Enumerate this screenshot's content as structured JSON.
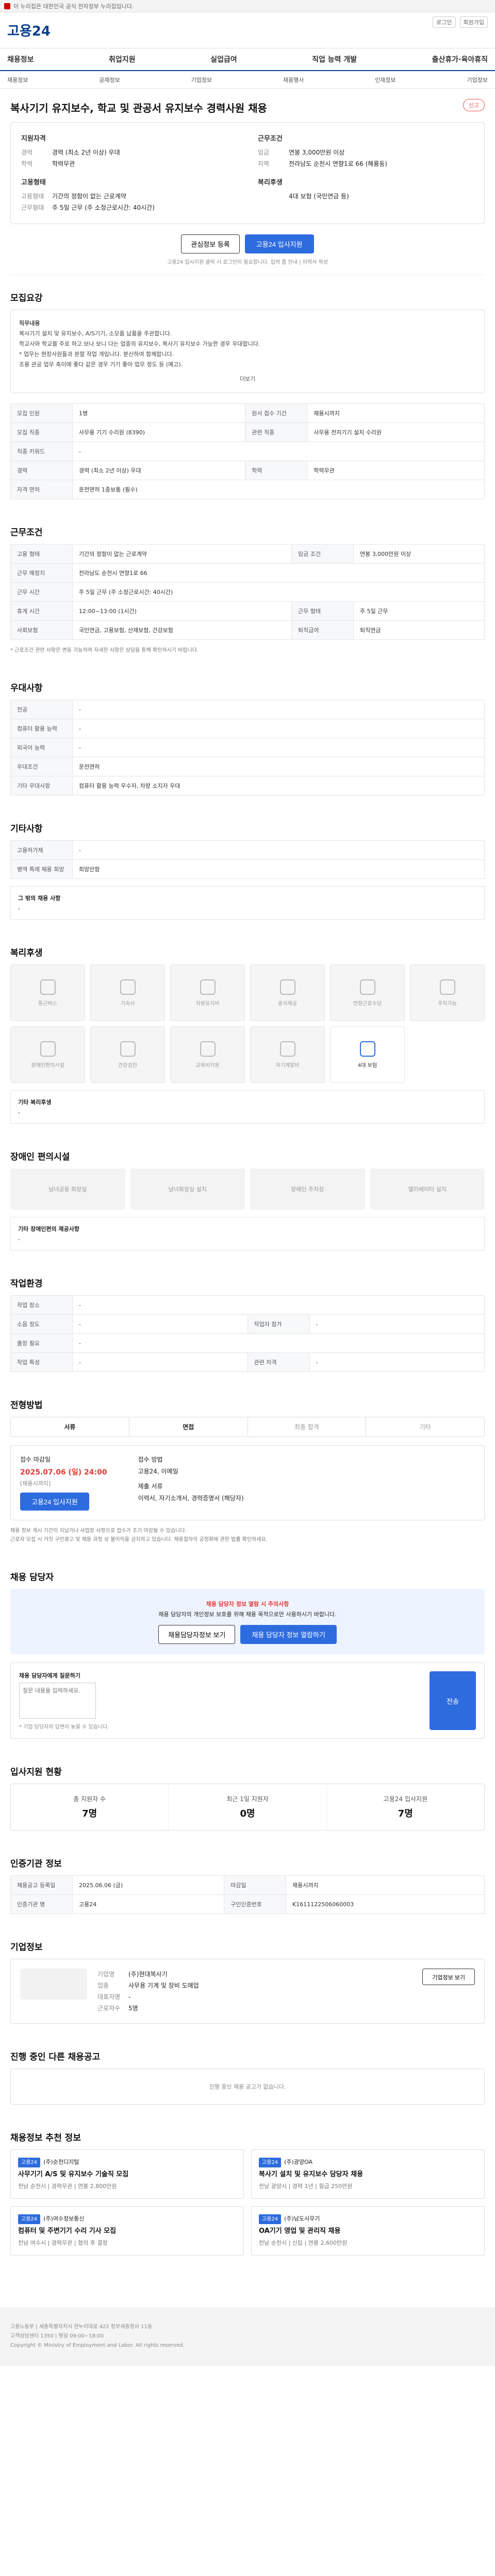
{
  "topbar": {
    "text": "이 누리집은 대한민국 공식 전자정부 누리집입니다."
  },
  "header": {
    "logo_main": "고용24",
    "links": [
      "로그인",
      "회원가입"
    ]
  },
  "gnb": [
    "채용정보",
    "취업지원",
    "실업급여",
    "직업 능력 개발",
    "출산휴가·육아휴직"
  ],
  "subnav": [
    "채용정보",
    "공채정보",
    "기업정보",
    "채용행사",
    "인재정보",
    "기업정보"
  ],
  "job": {
    "title": "복사기기 유지보수, 학교 및 관공서 유지보수 경력사원 채용",
    "report": "신고"
  },
  "summary": {
    "left_title": "지원자격",
    "left": [
      {
        "k": "경력",
        "v": "경력 (최소 2년 이상) 우대"
      },
      {
        "k": "학력",
        "v": "학력무관"
      }
    ],
    "left_title2": "고용형태",
    "left2": [
      {
        "k": "고용형태",
        "v": "기간의 정함이 없는 근로계약"
      },
      {
        "k": "근무형태",
        "v": "주 5일 근무 (주 소정근로시간: 40시간)"
      }
    ],
    "right_title": "근무조건",
    "right": [
      {
        "k": "임금",
        "v": "연봉 3,000만원 이상"
      },
      {
        "k": "지역",
        "v": "전라남도 순천시 연향1로 66 (해룡동)"
      }
    ],
    "right_title2": "복리후생",
    "right2": [
      {
        "k": "",
        "v": "4대 보험 (국민연금 등)"
      }
    ]
  },
  "actions": {
    "save": "관심정보 등록",
    "apply": "고용24 입사지원",
    "note": "고용24 입사지원 클릭 시 로그인이 필요합니다. 입력 폼 안내 | 이력서 작성"
  },
  "desc": {
    "title": "모집요강",
    "lines": [
      "직무내용",
      "복사기기 설치 및 유지보수, A/S기기, 소모품 납품을 주관합니다.",
      "학교사와 학교를 주로 하고 보나 보니 다는 업종의 유지보수, 복사기 유지보수 가능한 경우 우대합니다.",
      "* 업무는 현장사원들과 분할 작업 개입니다. 분산하여 함께합니다.",
      "조용 관공 업무 축이에 좋다 같은 경우 기기 좋아 업무 정도 등 (예고)."
    ],
    "more": "더보기"
  },
  "recruit_table": {
    "title": "",
    "rows": [
      [
        "모집 인원",
        "1명",
        "원서 접수 기간",
        "채용시까지"
      ],
      [
        "모집 직종",
        "사무용 기기 수리원 (8390)",
        "관련 직종",
        "사무용 전자기기 설치 수리원"
      ],
      [
        "직종 키워드",
        "-",
        "",
        ""
      ],
      [
        "경력",
        "경력 (최소 2년 이상) 우대",
        "학력",
        "학력무관"
      ],
      [
        "자격 면허",
        "운전면허 1종보통 (필수)",
        "",
        ""
      ]
    ]
  },
  "work_cond": {
    "title": "근무조건",
    "rows": [
      [
        "고용 형태",
        "기간의 정함이 없는 근로계약",
        "임금 조건",
        "연봉 3,000만원 이상"
      ],
      [
        "근무 예정지",
        "전라남도 순천시 연향1로 66",
        "",
        ""
      ],
      [
        "근무 시간",
        "주 5일 근무 (주 소정근로시간: 40시간)",
        "",
        ""
      ],
      [
        "휴게 시간",
        "12:00~13:00 (1시간)",
        "근무 형태",
        "주 5일 근무"
      ],
      [
        "사회보험",
        "국민연금, 고용보험, 산재보험, 건강보험",
        "퇴직급여",
        "퇴직연금"
      ]
    ],
    "note": "* 근로조건 관련 사항은 변동 가능하며 자세한 사항은 상담을 통해 확인하시기 바랍니다."
  },
  "prefer": {
    "title": "우대사항",
    "rows": [
      [
        "전공",
        "-"
      ],
      [
        "컴퓨터 활용 능력",
        "-"
      ],
      [
        "외국어 능력",
        "-"
      ],
      [
        "우대조건",
        "운전면허"
      ],
      [
        "기타 우대사항",
        "컴퓨터 활용 능력 우수자, 차량 소지자 우대"
      ]
    ]
  },
  "etc": {
    "title": "기타사항",
    "rows": [
      [
        "고용허가제",
        "-"
      ],
      [
        "병역 특례 채용 희망",
        "희망안함"
      ]
    ],
    "extra_label": "그 밖의 채용 사항",
    "extra_value": "-"
  },
  "welfare": {
    "title": "복리후생",
    "items": [
      {
        "label": "통근버스",
        "active": false
      },
      {
        "label": "기숙사",
        "active": false
      },
      {
        "label": "차량유지비",
        "active": false
      },
      {
        "label": "중식제공",
        "active": false
      },
      {
        "label": "연장근로수당",
        "active": false
      },
      {
        "label": "주차가능",
        "active": false
      },
      {
        "label": "장애인편의시설",
        "active": false
      },
      {
        "label": "건강검진",
        "active": false
      },
      {
        "label": "교육비지원",
        "active": false
      },
      {
        "label": "자기계발비",
        "active": false
      },
      {
        "label": "4대 보험",
        "active": true
      }
    ],
    "etc_label": "기타 복리후생",
    "etc_value": "-"
  },
  "disability": {
    "title": "장애인 편의시설",
    "items": [
      "남녀공용 화장실",
      "남녀화장실 설치",
      "장애인 주차장",
      "엘리베이터 설치"
    ],
    "etc_label": "기타 장애인편의 제공사항",
    "etc_value": "-"
  },
  "workplace": {
    "title": "작업환경",
    "rows": [
      [
        "작업 장소",
        "-",
        "",
        ""
      ],
      [
        "소음 정도",
        "-",
        "작업자 참가",
        "-"
      ],
      [
        "출장 필요",
        "-",
        "",
        ""
      ],
      [
        "작업 특성",
        "-",
        "관련 자격",
        "-"
      ]
    ]
  },
  "apply": {
    "title": "전형방법",
    "tabs": [
      "서류",
      "면접",
      "최종 합격",
      "기타"
    ],
    "deadline_label": "접수 마감일",
    "deadline": "2025.07.06 (일) 24:00",
    "deadline_note": "[채용시까지]",
    "method_label": "접수 방법",
    "method": "고용24, 이메일",
    "docs_label": "제출 서류",
    "docs": "이력서, 자기소개서, 경력증명서 (해당자)",
    "apply_btn": "고용24 입사지원",
    "notes": [
      "채용 정보 게시 기간이 지났거나 사업장 사정으로 접수가 조기 마감될 수 있습니다.",
      "근로자 모집 시 거짓 구인광고 및 채용 과정 상 불이익을 금지하고 있습니다. 채용절차의 공정화에 관한 법률 확인하세요."
    ]
  },
  "contact": {
    "title": "채용 담당자",
    "line1": "채용 담당자 정보 열람 시 주의사항",
    "line2": "채용 담당자의 개인정보 보호를 위해 채용 목적으로만 사용하시기 바랍니다.",
    "btn1": "채용담당자정보 보기",
    "btn2": "채용 담당자 정보 열람하기",
    "q_label": "채용 담당자에게 질문하기",
    "q_placeholder": "질문 내용을 입력하세요.",
    "q_send": "전송",
    "q_note": "* 기업 담당자의 답변이 늦을 수 있습니다."
  },
  "stats": {
    "title": "입사지원 현황",
    "items": [
      {
        "label": "총 지원자 수",
        "value": "7명"
      },
      {
        "label": "최근 1일 지원자",
        "value": "0명"
      },
      {
        "label": "고용24 입사지원",
        "value": "7명"
      }
    ]
  },
  "posting": {
    "title": "인증기관 정보",
    "rows": [
      [
        "채용공고 등록일",
        "2025.06.06 (금)",
        "마감일",
        "채용시까지"
      ],
      [
        "인증기관 명",
        "고용24",
        "구인인증번호",
        "K1611122506060003"
      ]
    ]
  },
  "company": {
    "title": "기업정보",
    "rows": [
      [
        "기업명",
        "(주)현대복사기"
      ],
      [
        "업종",
        "사무용 기계 및 장비 도매업"
      ],
      [
        "대표자명",
        "-"
      ],
      [
        "근로자수",
        "5명"
      ]
    ],
    "btn": "기업정보 보기"
  },
  "other": {
    "title": "진행 중인 다른 채용공고",
    "empty": "진행 중인 채용 공고가 없습니다."
  },
  "recommend": {
    "title": "채용정보 추천 정보",
    "cards": [
      {
        "badge": "고용24",
        "company": "(주)순천디지털",
        "title": "사무기기 A/S 및 유지보수 기술직 모집",
        "meta": "전남 순천시 | 경력무관 | 연봉 2,800만원"
      },
      {
        "badge": "고용24",
        "company": "(주)광양OA",
        "title": "복사기 설치 및 유지보수 담당자 채용",
        "meta": "전남 광양시 | 경력 1년 | 월급 250만원"
      },
      {
        "badge": "고용24",
        "company": "(주)여수정보통신",
        "title": "컴퓨터 및 주변기기 수리 기사 모집",
        "meta": "전남 여수시 | 경력무관 | 협의 후 결정"
      },
      {
        "badge": "고용24",
        "company": "(주)남도사무기",
        "title": "OA기기 영업 및 관리직 채용",
        "meta": "전남 순천시 | 신입 | 연봉 2,600만원"
      }
    ]
  },
  "footer": {
    "lines": [
      "고용노동부 | 세종특별자치시 한누리대로 422 정부세종청사 11동",
      "고객상담센터 1350 | 평일 09:00~18:00",
      "Copyright © Ministry of Employment and Labor. All rights reserved."
    ]
  }
}
